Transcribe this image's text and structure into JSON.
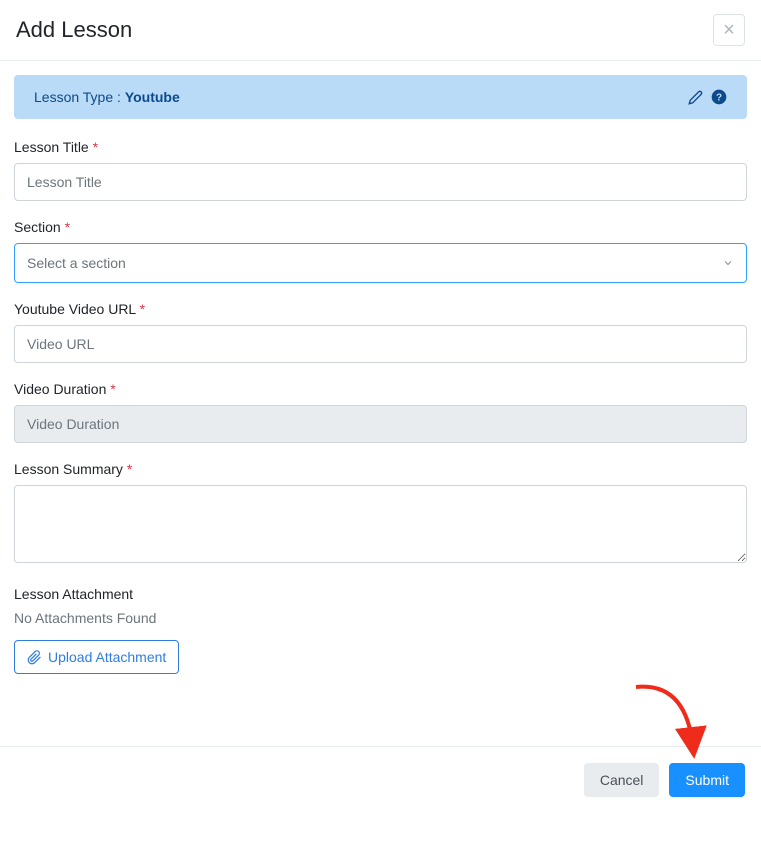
{
  "header": {
    "title": "Add Lesson"
  },
  "lessonType": {
    "labelPrefix": "Lesson Type : ",
    "value": "Youtube"
  },
  "fields": {
    "title": {
      "label": "Lesson Title",
      "placeholder": "Lesson Title"
    },
    "section": {
      "label": "Section",
      "placeholder": "Select a section"
    },
    "videoUrl": {
      "label": "Youtube Video URL",
      "placeholder": "Video URL"
    },
    "duration": {
      "label": "Video Duration",
      "placeholder": "Video Duration"
    },
    "summary": {
      "label": "Lesson Summary"
    },
    "attachment": {
      "label": "Lesson Attachment",
      "empty": "No Attachments Found",
      "uploadBtn": "Upload Attachment"
    }
  },
  "footer": {
    "cancel": "Cancel",
    "submit": "Submit"
  },
  "requiredMark": " *"
}
